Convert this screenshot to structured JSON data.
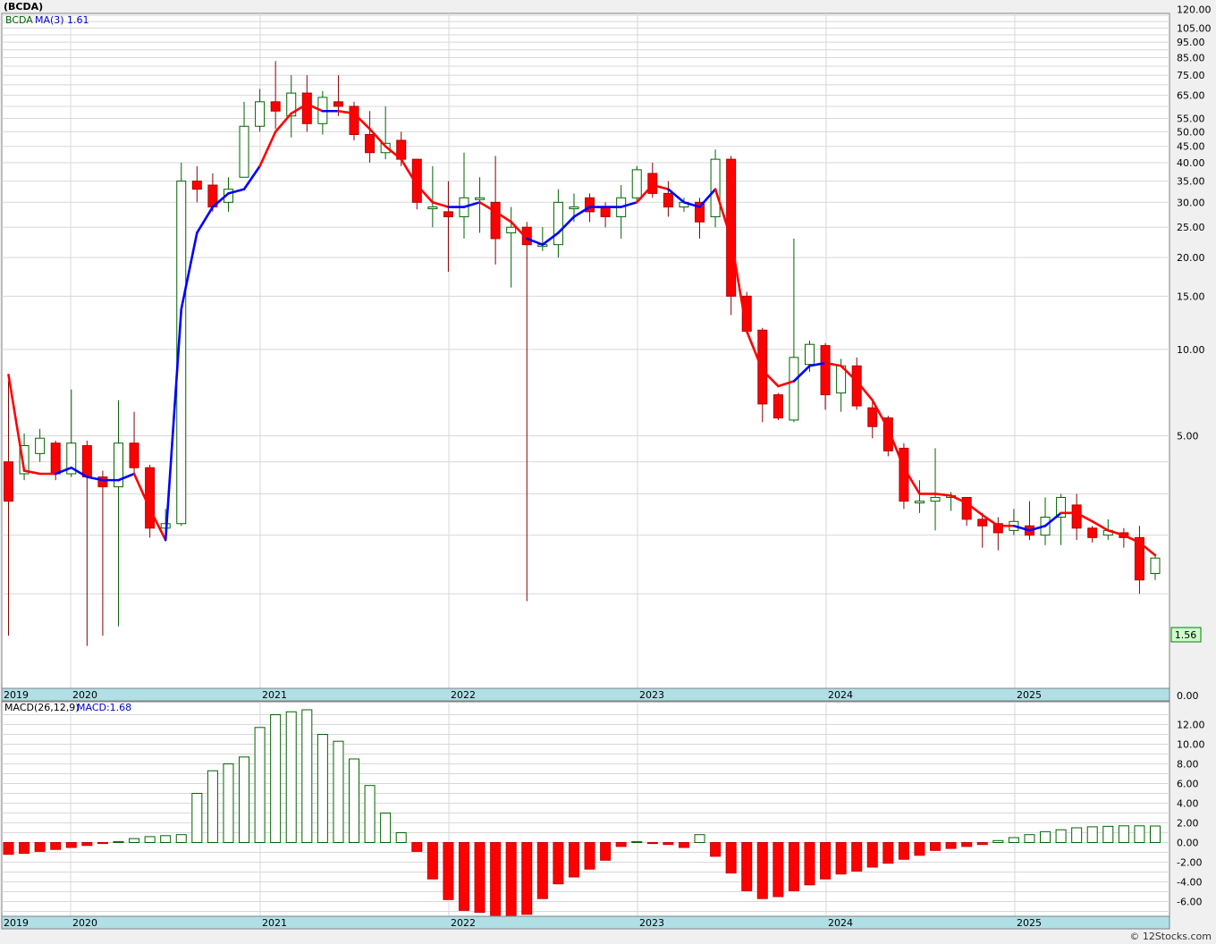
{
  "chart_data": [
    {
      "type": "candlestick",
      "title": "(BCDA)",
      "legend": {
        "symbol": "BCDA",
        "ma_label": "MA(3)",
        "ma_value": "1.61"
      },
      "scale": "log",
      "last_price_label": "1.56",
      "y_ticks": [
        "120.00",
        "105.00",
        "95.00",
        "85.00",
        "75.00",
        "65.00",
        "55.00",
        "50.00",
        "45.00",
        "40.00",
        "35.00",
        "30.00",
        "25.00",
        "20.00",
        "15.00",
        "10.00",
        "5.00",
        "0.00"
      ],
      "x_labels": [
        "2019",
        "2020",
        "2021",
        "2022",
        "2023",
        "2024",
        "2025"
      ],
      "candles": [
        [
          4.0,
          2.8,
          7.8,
          0.5
        ],
        [
          3.6,
          4.6,
          5.1,
          3.4
        ],
        [
          4.3,
          4.9,
          5.3,
          4.0
        ],
        [
          4.7,
          3.6,
          4.8,
          3.4
        ],
        [
          3.6,
          4.7,
          7.3,
          3.5
        ],
        [
          4.6,
          3.5,
          4.8,
          0.4
        ],
        [
          3.5,
          3.2,
          3.7,
          0.5
        ],
        [
          3.2,
          4.7,
          6.7,
          0.6
        ],
        [
          4.7,
          3.8,
          6.1,
          3.6
        ],
        [
          3.8,
          2.15,
          3.9,
          1.95
        ],
        [
          2.15,
          2.25,
          2.6,
          2.1
        ],
        [
          2.25,
          35,
          40,
          2.2
        ],
        [
          35,
          33,
          39,
          30
        ],
        [
          34,
          29,
          37,
          28
        ],
        [
          30,
          33,
          36,
          28
        ],
        [
          36,
          52,
          62,
          36
        ],
        [
          52,
          62,
          68,
          50
        ],
        [
          62,
          58,
          83,
          51
        ],
        [
          56,
          66,
          75,
          48
        ],
        [
          66,
          53,
          75,
          50
        ],
        [
          53,
          64,
          67,
          49
        ],
        [
          62,
          60,
          75,
          56
        ],
        [
          60,
          49,
          62,
          47
        ],
        [
          49,
          43,
          58,
          40
        ],
        [
          43,
          46,
          60,
          41
        ],
        [
          47,
          41,
          50,
          39
        ],
        [
          41,
          30,
          37,
          28.5
        ],
        [
          29,
          29,
          39,
          25
        ],
        [
          28,
          27,
          35,
          18
        ],
        [
          27,
          31,
          43,
          23
        ],
        [
          31,
          31,
          36,
          24
        ],
        [
          30,
          23,
          42,
          19
        ],
        [
          24,
          25,
          29,
          16
        ],
        [
          25,
          22,
          26,
          0.9
        ],
        [
          22,
          22,
          25,
          21
        ],
        [
          22,
          30,
          33,
          20
        ],
        [
          29,
          29,
          32,
          26
        ],
        [
          31,
          28,
          32,
          26
        ],
        [
          29,
          27,
          30,
          25
        ],
        [
          27,
          31,
          34,
          23
        ],
        [
          31,
          38,
          39,
          30
        ],
        [
          37,
          32,
          40,
          31
        ],
        [
          32,
          29,
          35,
          27
        ],
        [
          29,
          30,
          31,
          28
        ],
        [
          30,
          26,
          31,
          23
        ],
        [
          27,
          41,
          44,
          25
        ],
        [
          41,
          15,
          42,
          13
        ],
        [
          15,
          11.5,
          15.5,
          11.3
        ],
        [
          11.6,
          6.5,
          11.8,
          5.6
        ],
        [
          7.0,
          5.8,
          7.1,
          5.7
        ],
        [
          5.7,
          9.4,
          23,
          5.6
        ],
        [
          8.9,
          10.4,
          10.7,
          8.4
        ],
        [
          10.3,
          7.0,
          10.5,
          6.2
        ],
        [
          7.1,
          8.8,
          9.3,
          6.1
        ],
        [
          8.8,
          6.4,
          9.4,
          6.2
        ],
        [
          6.3,
          5.4,
          6.6,
          4.9
        ],
        [
          5.8,
          4.4,
          5.9,
          4.2
        ],
        [
          4.5,
          2.8,
          4.7,
          2.6
        ],
        [
          2.8,
          2.8,
          3.4,
          2.5
        ],
        [
          2.8,
          2.9,
          4.5,
          2.1
        ],
        [
          2.9,
          2.95,
          3.05,
          2.55
        ],
        [
          2.9,
          2.35,
          2.9,
          2.2
        ],
        [
          2.35,
          2.2,
          2.5,
          1.75
        ],
        [
          2.25,
          2.05,
          2.4,
          1.7
        ],
        [
          2.1,
          2.3,
          2.6,
          2.0
        ],
        [
          2.2,
          2.0,
          2.8,
          1.9
        ],
        [
          2.0,
          2.4,
          2.9,
          1.8
        ],
        [
          2.4,
          2.9,
          3.0,
          1.8
        ],
        [
          2.7,
          2.15,
          3.0,
          1.9
        ],
        [
          2.15,
          1.95,
          2.2,
          1.85
        ],
        [
          2.0,
          2.1,
          2.35,
          1.9
        ],
        [
          2.05,
          1.95,
          2.15,
          1.75
        ],
        [
          1.95,
          1.2,
          2.2,
          1.0
        ],
        [
          1.3,
          1.56,
          1.6,
          1.2
        ]
      ],
      "ma": [
        8.2,
        3.7,
        3.6,
        3.6,
        3.8,
        3.5,
        3.4,
        3.4,
        3.6,
        2.6,
        1.9,
        13.6,
        24,
        29,
        32,
        33,
        39,
        50,
        57,
        61,
        58,
        58,
        57,
        51,
        45,
        41,
        34,
        30,
        29,
        29,
        30,
        28,
        26,
        23,
        22,
        24,
        27,
        29,
        29,
        29,
        30,
        34,
        33,
        30,
        29,
        33,
        23,
        11.5,
        8.5,
        7.5,
        7.8,
        8.8,
        9.0,
        8.8,
        7.8,
        6.7,
        5.3,
        3.8,
        3.0,
        3.0,
        2.95,
        2.75,
        2.45,
        2.2,
        2.2,
        2.1,
        2.2,
        2.5,
        2.5,
        2.3,
        2.1,
        2.0,
        1.85,
        1.61
      ],
      "ma_blue_ranges": [
        [
          3,
          8
        ],
        [
          10,
          16
        ],
        [
          20,
          21
        ],
        [
          28,
          30
        ],
        [
          33,
          40
        ],
        [
          42,
          45
        ],
        [
          50,
          52
        ],
        [
          64,
          67
        ]
      ]
    },
    {
      "type": "bar",
      "title": "MACD(26,12,9)",
      "value_label": "MACD:1.68",
      "y_ticks": [
        "12.00",
        "10.00",
        "8.00",
        "6.00",
        "4.00",
        "2.00",
        "0.00",
        "-2.00",
        "-4.00",
        "-6.00"
      ],
      "x_labels": [
        "2019",
        "2020",
        "2021",
        "2022",
        "2023",
        "2024",
        "2025"
      ],
      "values": [
        -1.2,
        -1.1,
        -0.9,
        -0.7,
        -0.5,
        -0.3,
        -0.1,
        0.1,
        0.4,
        0.6,
        0.7,
        0.8,
        5.0,
        7.3,
        8.0,
        8.7,
        11.7,
        13.0,
        13.3,
        13.5,
        11.0,
        10.3,
        8.5,
        5.8,
        3.0,
        1.0,
        -0.9,
        -3.7,
        -5.8,
        -6.9,
        -7.1,
        -7.4,
        -7.5,
        -7.3,
        -5.7,
        -4.2,
        -3.5,
        -2.7,
        -1.8,
        -0.4,
        0.1,
        -0.1,
        -0.2,
        -0.5,
        0.8,
        -1.4,
        -3.1,
        -4.9,
        -5.7,
        -5.5,
        -4.9,
        -4.3,
        -3.7,
        -3.2,
        -2.9,
        -2.5,
        -2.1,
        -1.7,
        -1.3,
        -0.8,
        -0.6,
        -0.4,
        -0.2,
        0.2,
        0.5,
        0.8,
        1.1,
        1.3,
        1.5,
        1.6,
        1.65,
        1.7,
        1.7,
        1.68
      ]
    }
  ],
  "watermark": "© 12Stocks.com"
}
